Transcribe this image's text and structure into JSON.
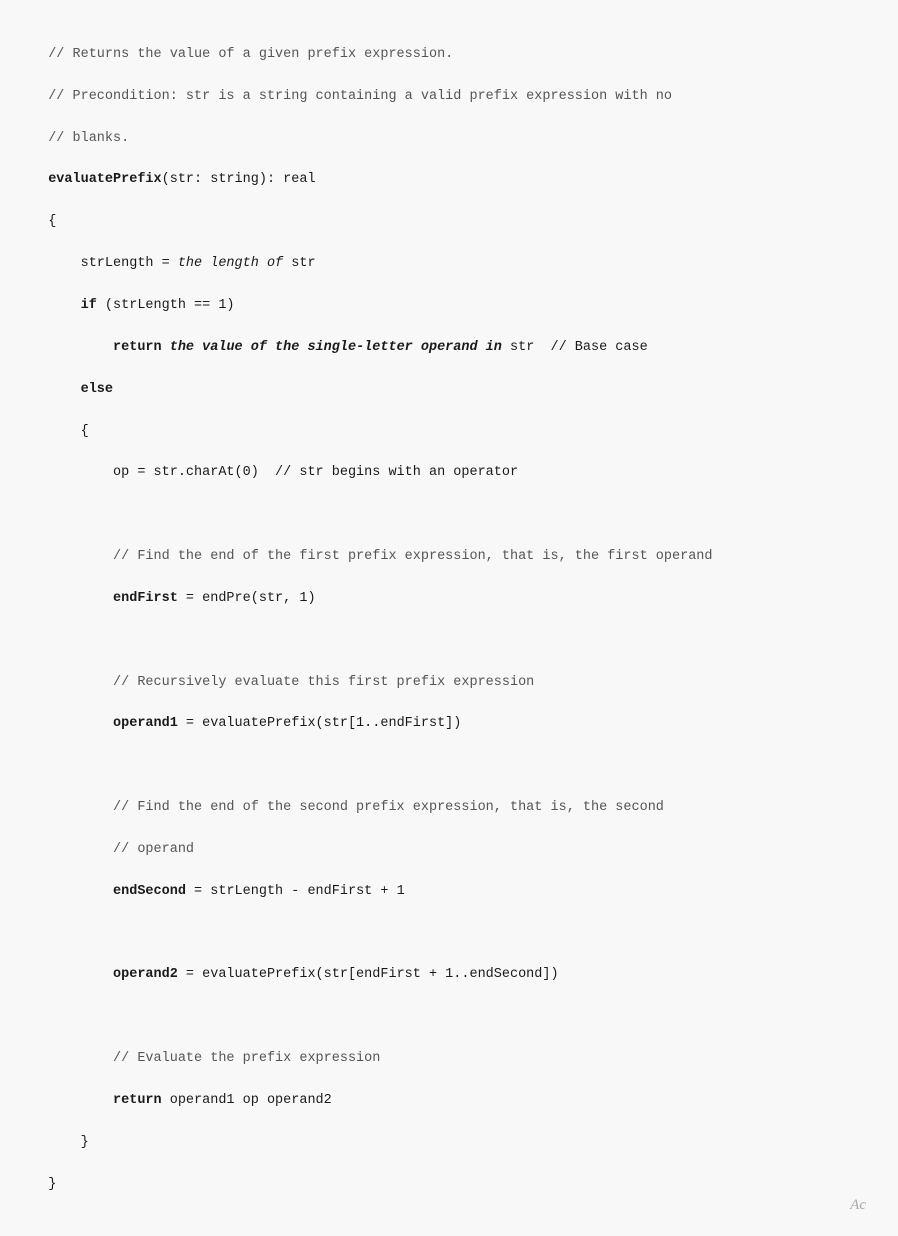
{
  "code": {
    "lines": [
      {
        "id": "l1",
        "type": "comment",
        "text": "// Returns the value of a given prefix expression."
      },
      {
        "id": "l2",
        "type": "comment",
        "text": "// Precondition: str is a string containing a valid prefix expression with no"
      },
      {
        "id": "l3",
        "type": "comment",
        "text": "// blanks."
      },
      {
        "id": "l4",
        "type": "signature",
        "text": "evaluatePrefix(str: string): real"
      },
      {
        "id": "l5",
        "type": "brace-open",
        "text": "{"
      },
      {
        "id": "l6",
        "type": "indent1-mixed",
        "parts": [
          {
            "text": "    strLength = ",
            "style": "normal"
          },
          {
            "text": "the length of",
            "style": "italic"
          },
          {
            "text": " str",
            "style": "normal"
          }
        ]
      },
      {
        "id": "l7",
        "type": "indent1-mixed",
        "parts": [
          {
            "text": "    ",
            "style": "normal"
          },
          {
            "text": "if",
            "style": "keyword"
          },
          {
            "text": " (strLength == 1)",
            "style": "normal"
          }
        ]
      },
      {
        "id": "l8",
        "type": "indent2-mixed",
        "parts": [
          {
            "text": "        ",
            "style": "normal"
          },
          {
            "text": "return",
            "style": "keyword"
          },
          {
            "text": " ",
            "style": "normal"
          },
          {
            "text": "the value of the single-letter operand in",
            "style": "bold-italic"
          },
          {
            "text": " str  // Base case",
            "style": "normal-comment"
          }
        ]
      },
      {
        "id": "l9",
        "type": "indent1-mixed",
        "parts": [
          {
            "text": "    ",
            "style": "normal"
          },
          {
            "text": "else",
            "style": "keyword"
          }
        ]
      },
      {
        "id": "l10",
        "type": "indent1",
        "text": "    {"
      },
      {
        "id": "l11",
        "type": "indent2-mixed",
        "parts": [
          {
            "text": "        op = str.charAt(0)  // str begins with an operator",
            "style": "normal"
          }
        ]
      },
      {
        "id": "l12",
        "type": "empty"
      },
      {
        "id": "l13",
        "type": "comment-indent2",
        "text": "        // Find the end of the first prefix expression, that is, the first operand"
      },
      {
        "id": "l14",
        "type": "indent2-mixed",
        "parts": [
          {
            "text": "        ",
            "style": "normal"
          },
          {
            "text": "endFirst = endPre(str, 1)",
            "style": "keyword-bold"
          }
        ]
      },
      {
        "id": "l15",
        "type": "empty"
      },
      {
        "id": "l16",
        "type": "comment-indent2",
        "text": "        // Recursively evaluate this first prefix expression"
      },
      {
        "id": "l17",
        "type": "indent2-mixed",
        "parts": [
          {
            "text": "        ",
            "style": "normal"
          },
          {
            "text": "operand1 = evaluatePrefix(str[1..endFirst])",
            "style": "keyword-bold"
          }
        ]
      },
      {
        "id": "l18",
        "type": "empty"
      },
      {
        "id": "l19",
        "type": "comment-indent2",
        "text": "        // Find the end of the second prefix expression, that is, the second"
      },
      {
        "id": "l20",
        "type": "comment-indent2",
        "text": "        // operand"
      },
      {
        "id": "l21",
        "type": "indent2-mixed",
        "parts": [
          {
            "text": "        ",
            "style": "normal"
          },
          {
            "text": "endSecond = strLength - endFirst + 1",
            "style": "keyword-bold"
          }
        ]
      },
      {
        "id": "l22",
        "type": "empty"
      },
      {
        "id": "l23",
        "type": "indent2-mixed",
        "parts": [
          {
            "text": "        ",
            "style": "normal"
          },
          {
            "text": "operand2 = evaluatePrefix(str[endFirst + 1..endSecond])",
            "style": "keyword-bold"
          }
        ]
      },
      {
        "id": "l24",
        "type": "empty"
      },
      {
        "id": "l25",
        "type": "comment-indent2",
        "text": "        // Evaluate the prefix expression"
      },
      {
        "id": "l26",
        "type": "indent2-mixed",
        "parts": [
          {
            "text": "        ",
            "style": "normal"
          },
          {
            "text": "return",
            "style": "keyword"
          },
          {
            "text": " operand1 op operand2",
            "style": "normal"
          }
        ]
      },
      {
        "id": "l27",
        "type": "indent1",
        "text": "    }"
      },
      {
        "id": "l28",
        "type": "brace-close",
        "text": "}"
      }
    ]
  },
  "watermark": {
    "text": "Ac"
  }
}
